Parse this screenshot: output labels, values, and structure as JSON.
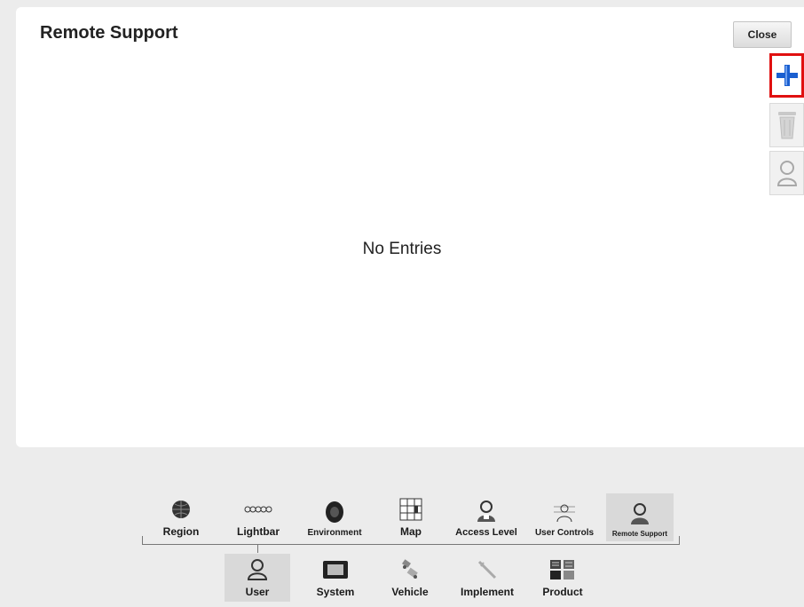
{
  "header": {
    "title": "Remote Support",
    "close_label": "Close"
  },
  "main": {
    "empty_text": "No Entries"
  },
  "side_actions": [
    {
      "name": "add",
      "icon": "plus-icon"
    },
    {
      "name": "delete",
      "icon": "trash-icon"
    },
    {
      "name": "user",
      "icon": "person-icon"
    }
  ],
  "tabs_top": [
    {
      "label": "Region",
      "icon": "globe-icon"
    },
    {
      "label": "Lightbar",
      "icon": "lightbar-icon"
    },
    {
      "label": "Environment",
      "icon": "speaker-icon"
    },
    {
      "label": "Map",
      "icon": "map-grid-icon"
    },
    {
      "label": "Access Level",
      "icon": "user-lock-icon"
    },
    {
      "label": "User Controls",
      "icon": "user-controls-icon"
    },
    {
      "label": "Remote Support",
      "icon": "remote-support-icon",
      "selected": true
    }
  ],
  "tabs_bottom": [
    {
      "label": "User",
      "icon": "user-icon",
      "selected": true
    },
    {
      "label": "System",
      "icon": "system-icon"
    },
    {
      "label": "Vehicle",
      "icon": "vehicle-icon"
    },
    {
      "label": "Implement",
      "icon": "implement-icon"
    },
    {
      "label": "Product",
      "icon": "product-icon"
    }
  ],
  "colors": {
    "accent_add": "#1a5fd0",
    "highlight_border": "#e01010",
    "selected_tab": "#d9d9d9"
  }
}
